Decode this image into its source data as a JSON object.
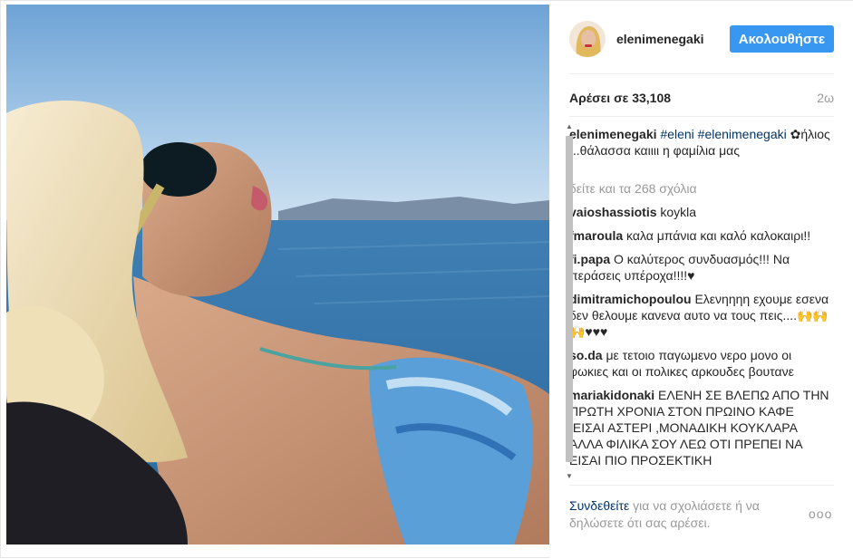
{
  "post": {
    "username": "elenimenegaki",
    "follow_label": "Ακολουθήστε",
    "likes": "Αρέσει σε 33,108",
    "time_ago": "2ω"
  },
  "caption": {
    "username": "elenimenegaki",
    "tag1": "#eleni",
    "tag2": "#elenimenegaki",
    "text": "✿ήλιος ...θάλασσα καιιιι η φαμίλια μας",
    "extra": "▫"
  },
  "view_all": "δείτε και τα 268 σχόλια",
  "comments": [
    {
      "user": "vaioshassiotis",
      "text": "koykla"
    },
    {
      "user": "fmaroula",
      "text": "καλα μπάνια και καλό καλοκαιρι!!"
    },
    {
      "user": "fi.papa",
      "text": "Ο καλύτερος συνδυασμός!!! Να περάσεις υπέροχα!!!!♥"
    },
    {
      "user": "dimitramichopoulou",
      "text": "Ελενηηηη εχουμε εσενα δεν θελουμε κανενα αυτο να τους πεις....🙌🙌🙌♥♥♥"
    },
    {
      "user": "so.da",
      "text": "με τετοιο παγωμενο νερο μονο οι φωκιες και οι πολικες αρκουδες βουτανε"
    },
    {
      "user": "mariakidonaki",
      "text": "ΕΛΕΝΗ ΣΕ ΒΛΕΠΩ ΑΠΟ ΤΗΝ ΠΡΩΤΗ ΧΡΟΝΙΑ ΣΤΟΝ ΠΡΩΙΝΟ ΚΑΦΕ ,ΕΙΣΑΙ ΑΣΤΕΡΙ ,ΜΟΝΑΔΙΚΗ ΚΟΥΚΛΑΡΑ ΑΛΛΑ ΦΙΛΙΚΑ ΣΟΥ ΛΕΩ ΟΤΙ ΠΡΕΠΕΙ ΝΑ ΕΙΣΑΙ ΠΙΟ ΠΡΟΣΕΚΤΙΚΗ"
    }
  ],
  "footer": {
    "login_link": "Συνδεθείτε",
    "login_text": " για να σχολιάσετε ή να δηλώσετε ότι σας αρέσει.",
    "more_label": "ooo"
  },
  "icons": {
    "more": "more-options-icon",
    "scroll_up": "scroll-up-arrow-icon",
    "scroll_down": "scroll-down-arrow-icon"
  },
  "colors": {
    "follow_bg": "#3897f0",
    "link": "#003569",
    "muted": "#999999"
  }
}
